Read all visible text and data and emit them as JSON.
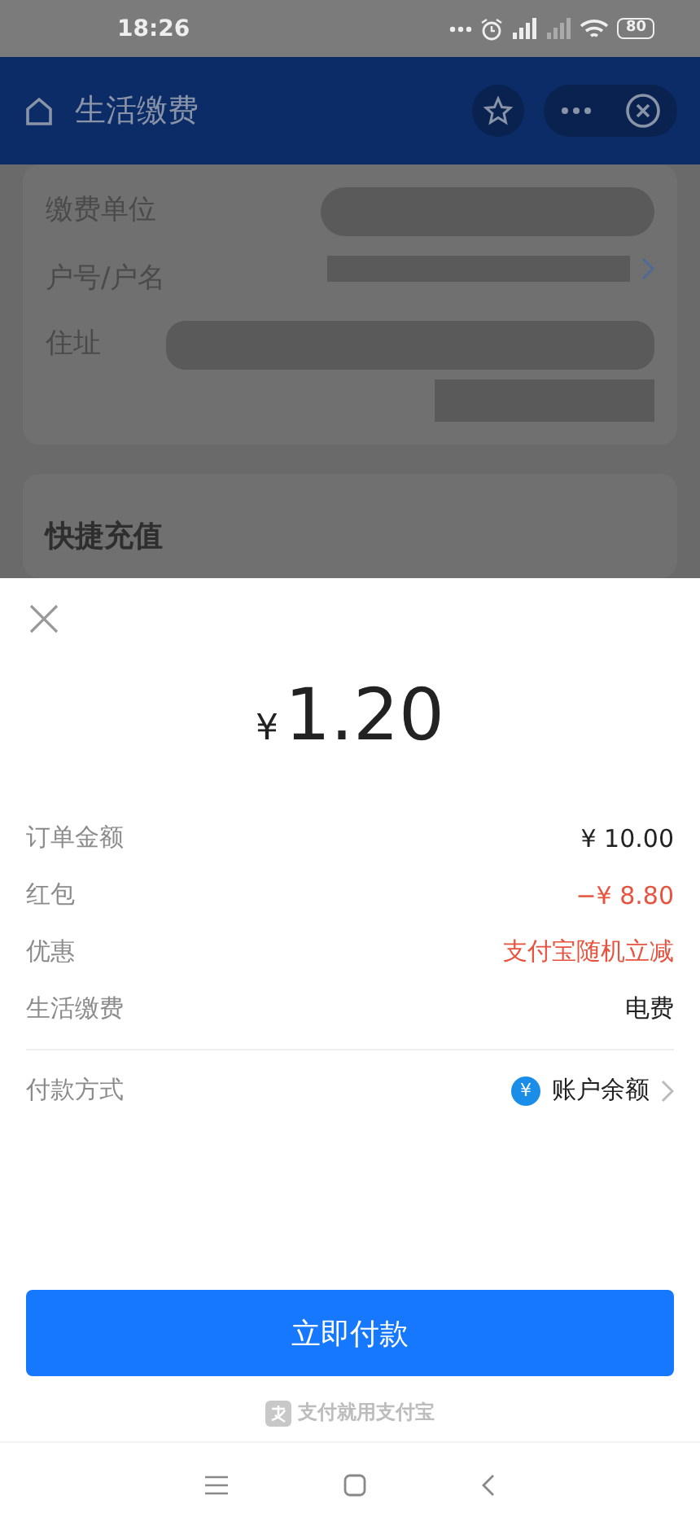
{
  "status_bar": {
    "time": "18:26",
    "battery": "80"
  },
  "nav": {
    "title": "生活缴费"
  },
  "account_card": {
    "fields": [
      {
        "label": "缴费单位",
        "kind": "pill"
      },
      {
        "label": "户号/户名",
        "kind": "link"
      },
      {
        "label": "住址",
        "kind": "multiline"
      }
    ]
  },
  "quick_card": {
    "title": "快捷充值"
  },
  "sheet": {
    "currency": "¥",
    "amount": "1.20",
    "rows": [
      {
        "label": "订单金额",
        "value": "¥ 10.00",
        "highlight": false
      },
      {
        "label": "红包",
        "value": "−¥ 8.80",
        "highlight": true
      },
      {
        "label": "优惠",
        "value": "支付宝随机立减",
        "highlight": true
      },
      {
        "label": "生活缴费",
        "value": "电费",
        "highlight": false
      }
    ],
    "payment": {
      "label": "付款方式",
      "badge": "¥",
      "value": "账户余额"
    },
    "pay_button": "立即付款",
    "footer": "支付就用支付宝"
  }
}
